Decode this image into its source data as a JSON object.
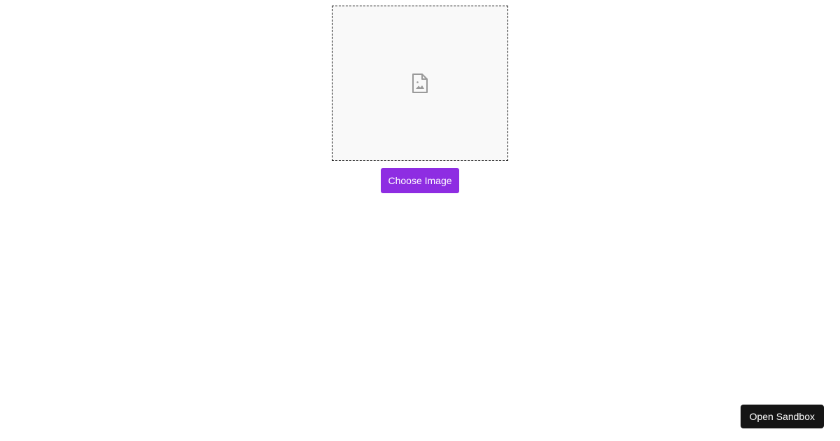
{
  "uploader": {
    "placeholder_icon": "image-file-icon",
    "choose_label": "Choose Image"
  },
  "sandbox": {
    "label": "Open Sandbox"
  },
  "colors": {
    "accent": "#8e2de2",
    "sandbox_bg": "#151515",
    "icon": "#9a9a9a",
    "dropzone_bg": "#f9f9f9"
  }
}
